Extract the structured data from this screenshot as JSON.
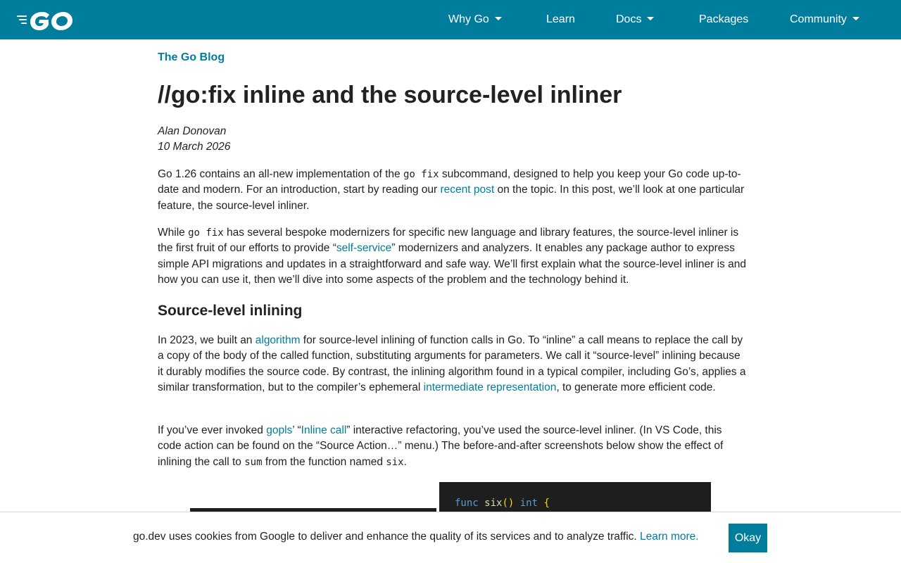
{
  "nav": {
    "items": [
      {
        "label": "Why Go",
        "dropdown": true
      },
      {
        "label": "Learn",
        "dropdown": false
      },
      {
        "label": "Docs",
        "dropdown": true
      },
      {
        "label": "Packages",
        "dropdown": false
      },
      {
        "label": "Community",
        "dropdown": true
      }
    ],
    "logo_icon": "go-logo-icon",
    "colors": {
      "header": "#007d9c",
      "link": "#007d9c",
      "text": "#202224"
    }
  },
  "article": {
    "blog_link": "The Go Blog",
    "title": "//go:fix inline and the source-level inliner",
    "author": "Alan Donovan",
    "date": "10 March 2026",
    "p1": {
      "t1": "Go 1.26 contains an all-new implementation of the ",
      "code1": "go fix",
      "t2": " subcommand, designed to help you keep your Go code up-to-date and modern. For an introduction, start by reading our ",
      "link1": "recent post",
      "t3": " on the topic. In this post, we’ll look at one particular feature, the source-level inliner."
    },
    "p2": {
      "t1": "While ",
      "code1": "go fix",
      "t2": " has several bespoke modernizers for specific new language and library features, the source-level inliner is the first fruit of our efforts to provide “",
      "link1": "self-service",
      "t3": "” modernizers and analyzers. It enables any package author to express simple API migrations and updates in a straightforward and safe way. We’ll first explain what the source-level inliner is and how you can use it, then we’ll dive into some aspects of the problem and the technology behind it."
    },
    "heading1": "Source-level inlining",
    "p3": {
      "t1": "In 2023, we built an ",
      "link1": "algorithm",
      "t2": " for source-level inlining of function calls in Go. To “inline” a call means to replace the call by a copy of the body of the called function, substituting arguments for parameters. We call it “source-level” inlining because it durably modifies the source code. By contrast, the inlining algorithm found in a typical compiler, including Go’s, applies a similar transformation, but to the compiler’s ephemeral ",
      "link2": "intermediate representation",
      "t3": ", to generate more efficient code."
    },
    "p4": {
      "t1": "If you’ve ever invoked ",
      "link1": "gopls",
      "t2": "’ “",
      "link2": "Inline call",
      "t3": "” interactive refactoring, you’ve used the source-level inliner. (In VS Code, this code action can be found on the “Source Action…” menu.) The before-and-after screenshots below show the effect of inlining the call to ",
      "code1": "sum",
      "t4": " from the function named ",
      "code2": "six",
      "t5": "."
    },
    "code_snippet": {
      "kw": "func",
      "name": "six",
      "parens": "()",
      "type": "int",
      "brace": "{"
    }
  },
  "cookie": {
    "text": "go.dev uses cookies from Google to deliver and enhance the quality of its services and to analyze traffic. ",
    "link": "Learn more.",
    "button": "Okay"
  }
}
